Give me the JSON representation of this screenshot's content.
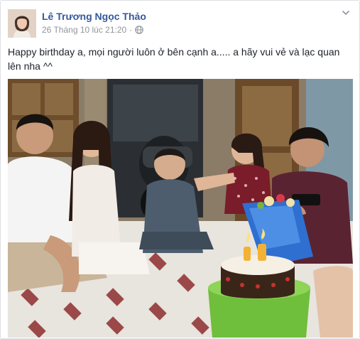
{
  "post": {
    "author": "Lê Trương Ngọc Thảo",
    "timestamp": "26 Tháng 10 lúc 21:20",
    "separator": "·",
    "message": "Happy birthday a, mọi người luôn ở bên cạnh a..... a hãy vui vẻ và lạc quan lên nha ^^"
  },
  "icons": {
    "privacy": "globe-icon",
    "options": "chevron-down-icon"
  },
  "colors": {
    "author_link": "#365899",
    "meta_text": "#90949c",
    "body_text": "#1d2129",
    "border": "#dddfe2"
  }
}
